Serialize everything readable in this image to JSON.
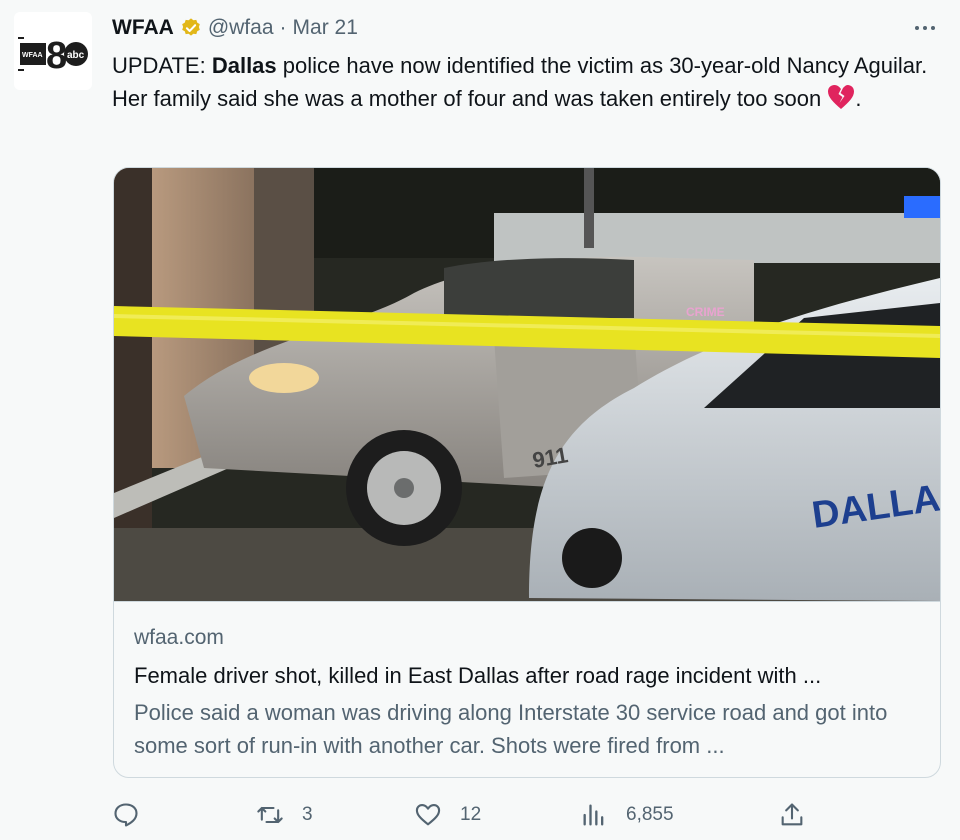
{
  "author": {
    "name": "WFAA",
    "handle": "@wfaa",
    "separator": "·",
    "date": "Mar 21",
    "avatar_logo_text": "WFAA 8 abc"
  },
  "tweet": {
    "prefix": "UPDATE: ",
    "bold_word": "Dallas",
    "body": " police have now identified the victim as 30-year-old Nancy Aguilar. Her family said she was a mother of four and was taken entirely too soon ",
    "emoji": "broken-heart",
    "suffix": "."
  },
  "card": {
    "image_description_labels": [
      "CRIME SCENE",
      "911",
      "DALLAS"
    ],
    "domain": "wfaa.com",
    "title": "Female driver shot, killed in East Dallas after road rage incident with ...",
    "description": "Police said a woman was driving along Interstate 30 service road and got into some sort of run-in with another car. Shots were fired from ..."
  },
  "actions": {
    "replies": "",
    "retweets": "3",
    "likes": "12",
    "views": "6,855"
  },
  "colors": {
    "accent_text": "#536471",
    "verified_gold": "#e2b719",
    "tape_yellow": "#e8e321",
    "heart_red": "#e0245e"
  }
}
